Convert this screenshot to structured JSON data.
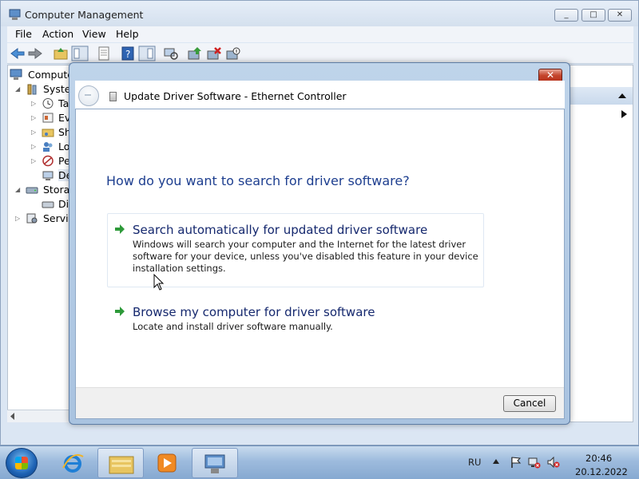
{
  "computer_management": {
    "title": "Computer Management",
    "window_controls": [
      "_",
      "□",
      "✕"
    ],
    "menu": [
      "File",
      "Action",
      "View",
      "Help"
    ],
    "tree": [
      {
        "label": "Computer",
        "level": 0,
        "expander": ""
      },
      {
        "label": "System",
        "level": 1,
        "expander": "◢"
      },
      {
        "label": "Ta",
        "level": 2,
        "expander": "▷"
      },
      {
        "label": "Eve",
        "level": 2,
        "expander": "▷"
      },
      {
        "label": "Sh",
        "level": 2,
        "expander": "▷"
      },
      {
        "label": "Lo",
        "level": 2,
        "expander": "▷"
      },
      {
        "label": "Pe",
        "level": 2,
        "expander": "▷"
      },
      {
        "label": "De",
        "level": 2,
        "expander": ""
      },
      {
        "label": "Storag",
        "level": 1,
        "expander": "◢"
      },
      {
        "label": "Dis",
        "level": 2,
        "expander": ""
      },
      {
        "label": "Service",
        "level": 1,
        "expander": "▷"
      }
    ]
  },
  "dialog": {
    "close_label": "✕",
    "header_title": "Update Driver Software - Ethernet Controller",
    "question": "How do you want to search for driver software?",
    "options": [
      {
        "title": "Search automatically for updated driver software",
        "description": "Windows will search your computer and the Internet for the latest driver software for your device, unless you've disabled this feature in your device installation settings."
      },
      {
        "title": "Browse my computer for driver software",
        "description": "Locate and install driver software manually."
      }
    ],
    "cancel_label": "Cancel"
  },
  "taskbar": {
    "language": "RU",
    "time": "20:46",
    "date": "20.12.2022"
  },
  "colors": {
    "accent_blue": "#1d3e8f",
    "option_title": "#15286e",
    "arrow_green": "#2e9a3a",
    "close_red": "#c4452c"
  }
}
